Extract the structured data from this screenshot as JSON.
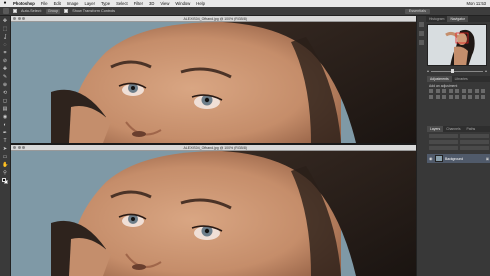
{
  "menubar": {
    "apple": "",
    "items": [
      "Photoshop",
      "File",
      "Edit",
      "Image",
      "Layer",
      "Type",
      "Select",
      "Filter",
      "3D",
      "View",
      "Window",
      "Help"
    ],
    "right": [
      "Mon 11:53"
    ]
  },
  "options_bar": {
    "auto_select_label": "Auto-Select:",
    "auto_select_value": "Group",
    "show_transform_label": "Show Transform Controls",
    "workspace": "Essentials"
  },
  "toolbar": {
    "tools": [
      "move-tool",
      "marquee-tool",
      "lasso-tool",
      "quick-select-tool",
      "crop-tool",
      "eyedropper-tool",
      "healing-brush-tool",
      "brush-tool",
      "clone-stamp-tool",
      "history-brush-tool",
      "eraser-tool",
      "gradient-tool",
      "blur-tool",
      "dodge-tool",
      "pen-tool",
      "type-tool",
      "path-select-tool",
      "shape-tool",
      "hand-tool",
      "zoom-tool"
    ],
    "glyphs": [
      "✥",
      "⬚",
      "ʆ",
      "◌",
      "⌗",
      "⊘",
      "✚",
      "✎",
      "⊕",
      "⟲",
      "◻",
      "▤",
      "◉",
      "◐",
      "✒",
      "T",
      "➤",
      "▭",
      "✋",
      "⚲"
    ],
    "fg_color": "#111111",
    "bg_color": "#ffffff"
  },
  "documents": [
    {
      "title": "ALEXIS04_Ofhand.jpg @ 100% (RGB/8)"
    },
    {
      "title": "ALEXIS04_Ofhand.jpg @ 100% (RGB/8)"
    }
  ],
  "panels": {
    "navigator_tabs": [
      "Histogram",
      "Navigator"
    ],
    "adjust_tabs": [
      "Adjustments",
      "Libraries"
    ],
    "adjust_title": "Add an adjustment",
    "layers_tabs": [
      "Layers",
      "Channels",
      "Paths"
    ],
    "layer_name": "Background"
  },
  "colors": {
    "background_blue": "#7f99a6",
    "skin": "#c9936f",
    "hair": "#2b211c",
    "ui_dark": "#383838"
  }
}
